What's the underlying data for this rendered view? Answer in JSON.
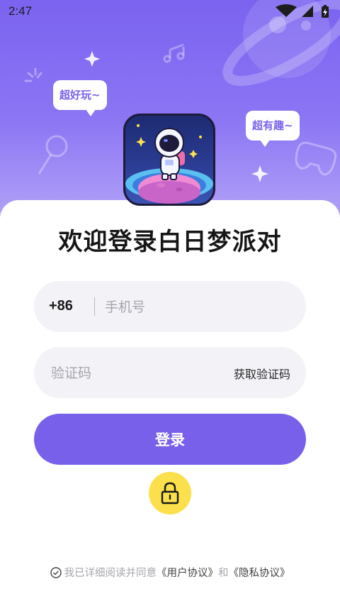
{
  "status_bar": {
    "time": "2:47",
    "icons": [
      "wifi-icon",
      "cellular-signal-icon",
      "battery-charging-icon"
    ]
  },
  "hero": {
    "bubble_left": "超好玩~",
    "bubble_right": "超有趣~",
    "app_icon": "astronaut-app-icon",
    "decorations": [
      "planet-icon",
      "music-note-icon",
      "microphone-icon",
      "gamepad-icon",
      "sparkle-icon"
    ]
  },
  "title": "欢迎登录白日梦派对",
  "phone_field": {
    "country_code": "+86",
    "placeholder": "手机号"
  },
  "code_field": {
    "placeholder": "验证码",
    "get_code_label": "获取验证码"
  },
  "login_button": {
    "label": "登录"
  },
  "lock_button": {
    "icon": "lock-icon"
  },
  "agreement": {
    "prefix": "我已详细阅读并同意",
    "user_agreement": "《用户协议》",
    "conjunction": "和",
    "privacy_policy": "《隐私协议》"
  },
  "colors": {
    "primary": "#7860ea",
    "hero_top": "#7b63f0",
    "field_bg": "#f2f2f7",
    "lock_yellow": "#fbe04c",
    "title": "#161616"
  }
}
